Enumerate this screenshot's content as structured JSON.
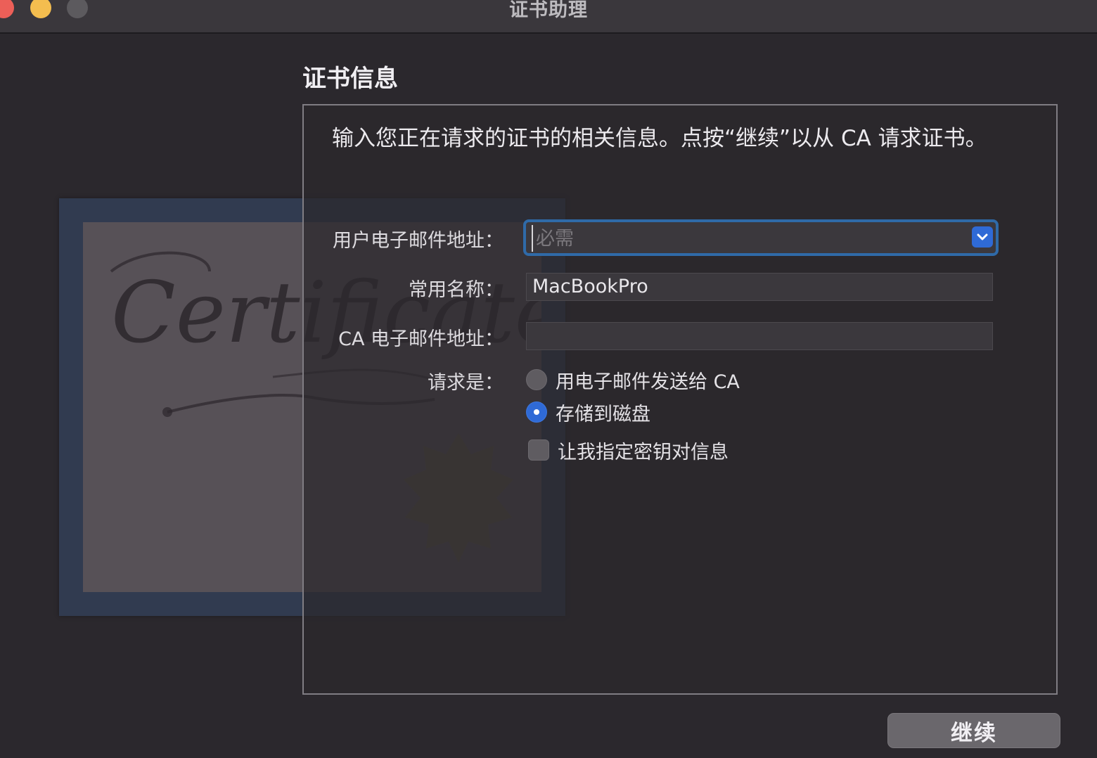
{
  "window": {
    "title": "证书助理"
  },
  "illustration": {
    "icon": "certificate-illustration",
    "script_text": "Certificate"
  },
  "section": {
    "title": "证书信息"
  },
  "intro": {
    "text": "输入您正在请求的证书的相关信息。点按“继续”以从 CA 请求证书。"
  },
  "form": {
    "user_email": {
      "label": "用户电子邮件地址：",
      "value": "",
      "placeholder": "必需"
    },
    "common_name": {
      "label": "常用名称：",
      "value": "MacBookPro"
    },
    "ca_email": {
      "label": "CA 电子邮件地址：",
      "value": ""
    },
    "request": {
      "label": "请求是：",
      "options": [
        {
          "label": "用电子邮件发送给 CA",
          "selected": false
        },
        {
          "label": "存储到磁盘",
          "selected": true
        }
      ]
    },
    "key_pair": {
      "label": "让我指定密钥对信息",
      "checked": false
    }
  },
  "buttons": {
    "continue": "继续"
  },
  "colors": {
    "accent": "#2f6ad6",
    "window_bg": "#2b282d",
    "close": "#ec5f58",
    "minimize": "#f4bd4f"
  }
}
